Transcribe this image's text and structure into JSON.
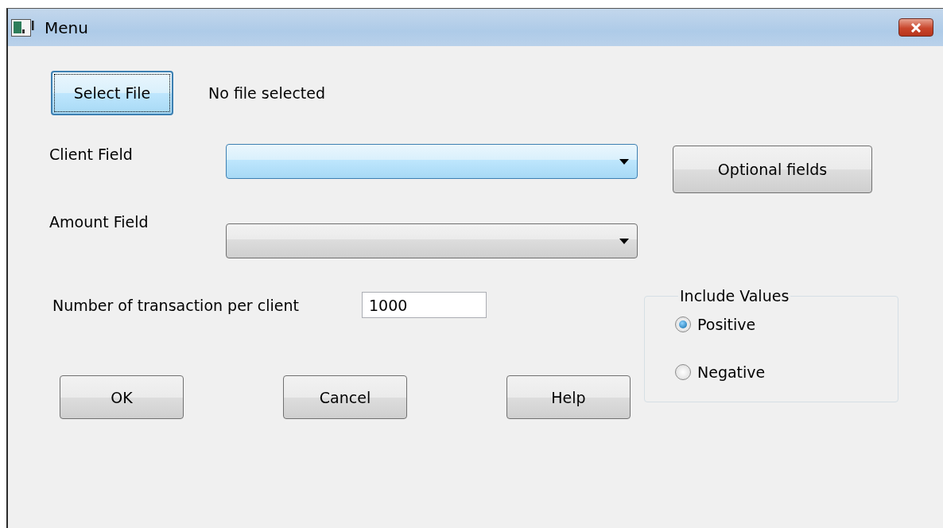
{
  "window": {
    "title": "Menu"
  },
  "select_file": {
    "button": "Select File",
    "focused": true,
    "status": "No file selected"
  },
  "fields": [
    {
      "label": "Client Field",
      "focused": true
    },
    {
      "label": "Amount Field",
      "focused": false
    }
  ],
  "optional_button": "Optional fields",
  "transactions": {
    "label": "Number of transaction per client",
    "value": "1000"
  },
  "include_values": {
    "title": "Include Values",
    "options": [
      {
        "label": "Positive",
        "selected": true
      },
      {
        "label": "Negative",
        "selected": false
      }
    ]
  },
  "buttons": [
    "OK",
    "Cancel",
    "Help"
  ]
}
